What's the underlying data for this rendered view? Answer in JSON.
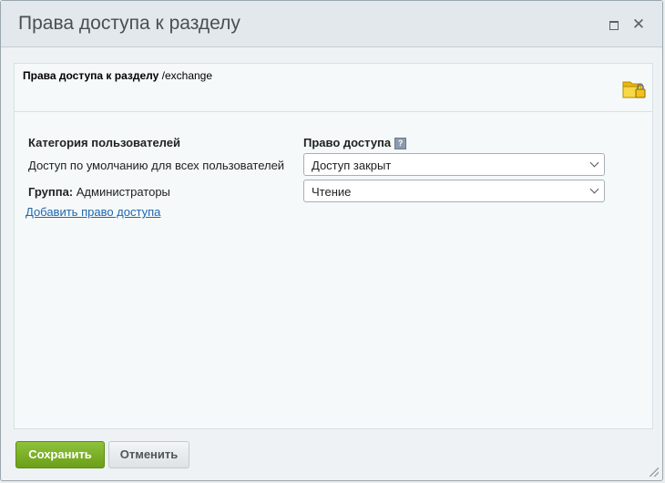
{
  "dialog": {
    "title": "Права доступа к разделу"
  },
  "icons": {
    "maximize": "maximize-icon",
    "close": "close-icon",
    "folder": "folder-lock-icon",
    "help": "help-icon",
    "chevron": "chevron-down-icon"
  },
  "header": {
    "label": "Права доступа к разделу",
    "path": "/exchange"
  },
  "table": {
    "col_users": "Категория пользователей",
    "col_access": "Право доступа",
    "help_glyph": "?",
    "rows": [
      {
        "label": "Доступ по умолчанию для всех пользователей",
        "value": "Доступ закрыт"
      },
      {
        "label_bold": "Группа:",
        "label": "Администраторы",
        "value": "Чтение"
      }
    ]
  },
  "add_link": "Добавить право доступа",
  "buttons": {
    "save": "Сохранить",
    "cancel": "Отменить"
  },
  "colors": {
    "save_button": "#7bb026",
    "link": "#2067b0",
    "folder": "#f5c518"
  }
}
